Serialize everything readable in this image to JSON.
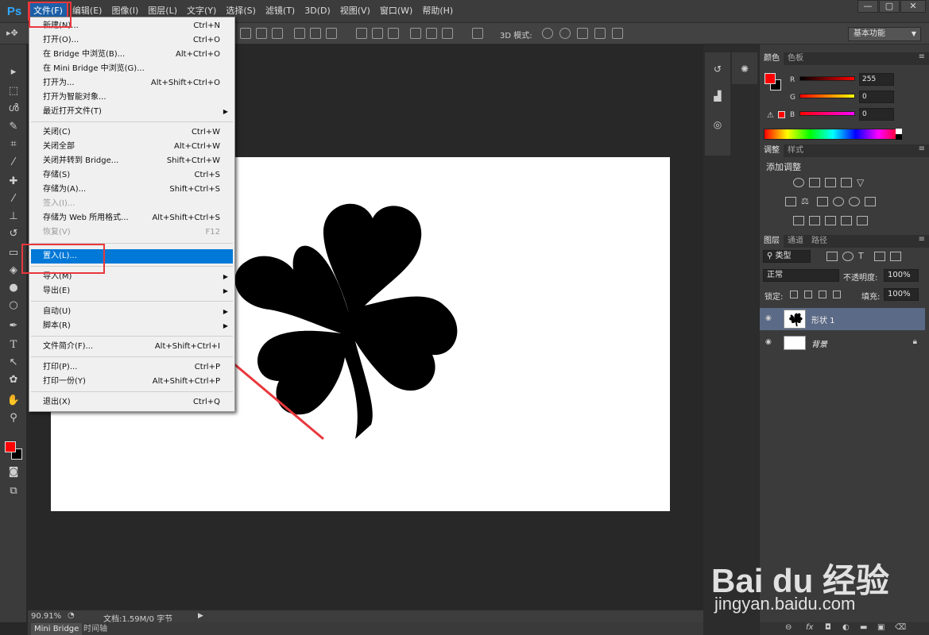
{
  "app": {
    "logo": "Ps"
  },
  "menubar": {
    "items": [
      "文件(F)",
      "编辑(E)",
      "图像(I)",
      "图层(L)",
      "文字(Y)",
      "选择(S)",
      "滤镜(T)",
      "3D(D)",
      "视图(V)",
      "窗口(W)",
      "帮助(H)"
    ],
    "window_controls": [
      "—",
      "▢",
      "✕"
    ]
  },
  "options_bar": {
    "mode_label": "3D 模式:",
    "workspace": "基本功能"
  },
  "file_menu": {
    "items": [
      {
        "label": "新建(N)...",
        "shortcut": "Ctrl+N"
      },
      {
        "label": "打开(O)...",
        "shortcut": "Ctrl+O"
      },
      {
        "label": "在 Bridge 中浏览(B)...",
        "shortcut": "Alt+Ctrl+O"
      },
      {
        "label": "在 Mini Bridge 中浏览(G)...",
        "shortcut": ""
      },
      {
        "label": "打开为...",
        "shortcut": "Alt+Shift+Ctrl+O"
      },
      {
        "label": "打开为智能对象...",
        "shortcut": ""
      },
      {
        "label": "最近打开文件(T)",
        "shortcut": "",
        "submenu": true
      },
      {
        "label": "关闭(C)",
        "shortcut": "Ctrl+W"
      },
      {
        "label": "关闭全部",
        "shortcut": "Alt+Ctrl+W"
      },
      {
        "label": "关闭并转到 Bridge...",
        "shortcut": "Shift+Ctrl+W"
      },
      {
        "label": "存储(S)",
        "shortcut": "Ctrl+S"
      },
      {
        "label": "存储为(A)...",
        "shortcut": "Shift+Ctrl+S"
      },
      {
        "label": "签入(I)...",
        "shortcut": "",
        "disabled": true
      },
      {
        "label": "存储为 Web 所用格式...",
        "shortcut": "Alt+Shift+Ctrl+S"
      },
      {
        "label": "恢复(V)",
        "shortcut": "F12",
        "disabled": true
      },
      {
        "label": "置入(L)...",
        "shortcut": "",
        "highlighted": true
      },
      {
        "label": "导入(M)",
        "shortcut": "",
        "submenu": true
      },
      {
        "label": "导出(E)",
        "shortcut": "",
        "submenu": true
      },
      {
        "label": "自动(U)",
        "shortcut": "",
        "submenu": true
      },
      {
        "label": "脚本(R)",
        "shortcut": "",
        "submenu": true
      },
      {
        "label": "文件简介(F)...",
        "shortcut": "Alt+Shift+Ctrl+I"
      },
      {
        "label": "打印(P)...",
        "shortcut": "Ctrl+P"
      },
      {
        "label": "打印一份(Y)",
        "shortcut": "Alt+Shift+Ctrl+P"
      },
      {
        "label": "退出(X)",
        "shortcut": "Ctrl+Q"
      }
    ]
  },
  "status_bar": {
    "zoom": "90.91%",
    "doc_info": "文档:1.59M/0 字节"
  },
  "bottom_tabs": [
    "Mini Bridge",
    "时间轴"
  ],
  "color_panel": {
    "tabs": [
      "颜色",
      "色板"
    ],
    "channels": [
      {
        "label": "R",
        "value": "255"
      },
      {
        "label": "G",
        "value": "0"
      },
      {
        "label": "B",
        "value": "0"
      }
    ],
    "foreground": "#ff0000",
    "background": "#000000"
  },
  "adjust_panel": {
    "tabs": [
      "调整",
      "样式"
    ],
    "title": "添加调整"
  },
  "layers_panel": {
    "tabs": [
      "图层",
      "通道",
      "路径"
    ],
    "filter_kind": "类型",
    "blend_mode": "正常",
    "opacity_label": "不透明度:",
    "opacity": "100%",
    "lock_label": "锁定:",
    "fill_label": "填充:",
    "fill": "100%",
    "layers": [
      {
        "name": "形状 1",
        "selected": true
      },
      {
        "name": "背景",
        "locked": true
      }
    ]
  },
  "watermark": {
    "brand": "Bai du 经验",
    "url": "jingyan.baidu.com"
  }
}
